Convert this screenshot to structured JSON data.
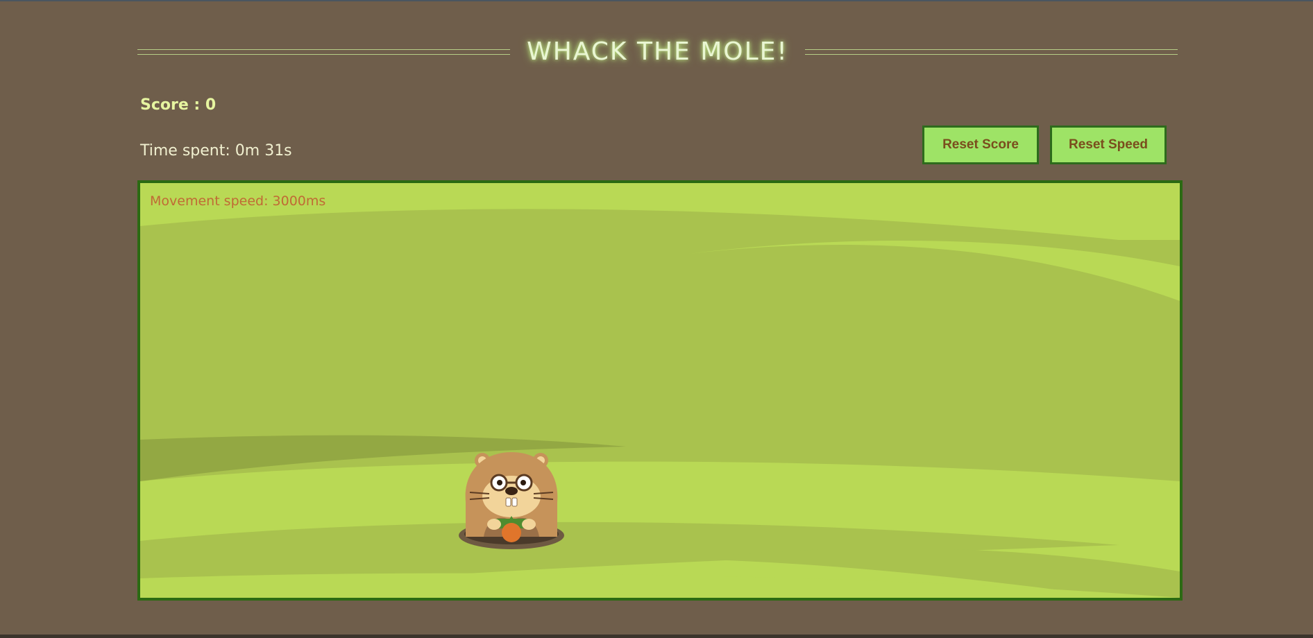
{
  "game": {
    "title": "WHACK THE MOLE!",
    "score_text": "Score : 0",
    "time_text": "Time spent: 0m 31s",
    "speed_text": "Movement speed: 3000ms"
  },
  "buttons": {
    "reset_score": "Reset Score",
    "reset_speed": "Reset Speed"
  },
  "colors": {
    "background": "#6f5e4b",
    "field_grass": "#a9c24e",
    "field_light": "#b9d955",
    "field_border": "#2b6a12",
    "button_fill": "#9ee366",
    "button_text": "#7a4d1d",
    "title_glow": "#c8f08c",
    "score_text": "#e6f5a0",
    "speed_text": "#c06a35"
  },
  "icons": {
    "mole": "mole-character-icon"
  }
}
